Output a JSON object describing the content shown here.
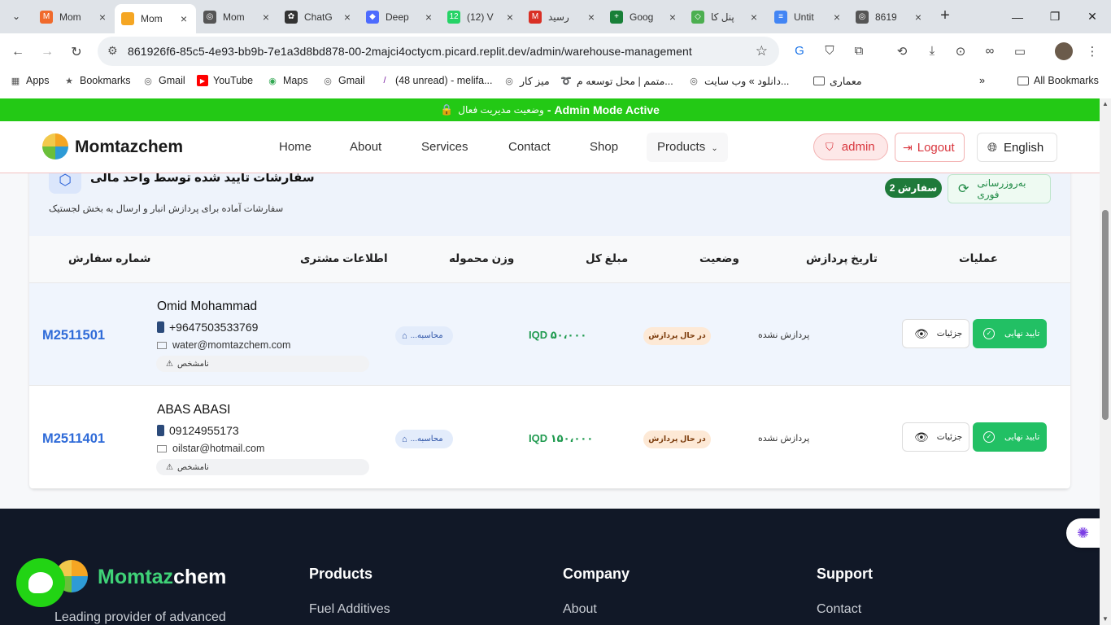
{
  "browser": {
    "tabs": [
      {
        "title": "Mom",
        "fav": "M",
        "color": "#f06a2c"
      },
      {
        "title": "Mom",
        "fav": "",
        "color": "#f5a623",
        "active": true
      },
      {
        "title": "Mom",
        "fav": "◎",
        "color": "#555"
      },
      {
        "title": "ChatG",
        "fav": "✿",
        "color": "#333"
      },
      {
        "title": "Deep",
        "fav": "◆",
        "color": "#4d6bfe"
      },
      {
        "title": "(12) V",
        "fav": "12",
        "color": "#25d366"
      },
      {
        "title": "رسید",
        "fav": "M",
        "color": "#d93025"
      },
      {
        "title": "Goog",
        "fav": "+",
        "color": "#188038"
      },
      {
        "title": "پنل کا",
        "fav": "◇",
        "color": "#4caf50"
      },
      {
        "title": "Untit",
        "fav": "≡",
        "color": "#4285f4"
      },
      {
        "title": "8619",
        "fav": "◎",
        "color": "#555"
      }
    ],
    "url": "861926f6-85c5-4e93-bb9b-7e1a3d8bd878-00-2majci4octycm.picard.replit.dev/admin/warehouse-management",
    "bookmarks": [
      {
        "label": "Apps",
        "icon": "apps-grid-icon"
      },
      {
        "label": "Bookmarks",
        "icon": "star-icon"
      },
      {
        "label": "Gmail",
        "icon": "globe-icon"
      },
      {
        "label": "YouTube",
        "icon": "youtube-icon"
      },
      {
        "label": "Maps",
        "icon": "maps-pin-icon"
      },
      {
        "label": "Gmail",
        "icon": "globe-icon"
      },
      {
        "label": "(48 unread) - melifa...",
        "icon": "yahoo-icon"
      },
      {
        "label": "میز کار",
        "icon": "globe-icon"
      },
      {
        "label": "متمم | محل توسعه م...",
        "icon": "motamem-icon"
      },
      {
        "label": "دانلود » وب سایت...",
        "icon": "globe-icon"
      },
      {
        "label": "معماری",
        "icon": "folder-icon"
      }
    ],
    "all_bookmarks": "All Bookmarks",
    "more_bookmarks": "»"
  },
  "admin_bar": {
    "label": "Admin Mode Active",
    "dash": "-",
    "fa_label": "وضعیت مدیریت فعال"
  },
  "header": {
    "brand": "Momtazchem",
    "nav": [
      "Home",
      "About",
      "Services",
      "Contact",
      "Shop",
      "Products"
    ],
    "admin_label": "admin",
    "logout_label": "Logout",
    "language_label": "English"
  },
  "card": {
    "title": "سفارشات تایید شده توسط واحد مالی",
    "subtitle": "سفارشات آماده برای پردازش انبار و ارسال به بخش لجستیک",
    "count_badge": "سفارش 2",
    "refresh_label": "بەروزرسانی فوری",
    "columns": {
      "order_no": "شماره سفارش",
      "customer": "اطلاعات مشتری",
      "weight": "وزن محموله",
      "amount": "مبلغ کل",
      "status": "وضعیت",
      "processing_date": "تاریخ پردازش",
      "actions": "عملیات"
    },
    "orders": [
      {
        "order_no": "M2511501",
        "name": "Omid Mohammad",
        "phone": "+9647503533769",
        "email": "water@momtazchem.com",
        "tag": "نامشخص",
        "weight": "...محاسبه",
        "amount": "IQD ۵۰،۰۰۰",
        "status": "در حال پردازش",
        "processing_date": "پردازش نشده",
        "details_label": "جزئیات",
        "confirm_label": "تایید نهایی"
      },
      {
        "order_no": "M2511401",
        "name": "ABAS ABASI",
        "phone": "09124955173",
        "email": "oilstar@hotmail.com",
        "tag": "نامشخص",
        "weight": "...محاسبه",
        "amount": "IQD ۱۵۰،۰۰۰",
        "status": "در حال پردازش",
        "processing_date": "پردازش نشده",
        "details_label": "جزئیات",
        "confirm_label": "تایید نهایی"
      }
    ]
  },
  "footer": {
    "brand_green": "Momtaz",
    "brand_white": "chem",
    "tagline": "Leading provider of advanced",
    "columns": [
      {
        "heading": "Products",
        "first_link": "Fuel Additives"
      },
      {
        "heading": "Company",
        "first_link": "About"
      },
      {
        "heading": "Support",
        "first_link": "Contact"
      }
    ]
  }
}
